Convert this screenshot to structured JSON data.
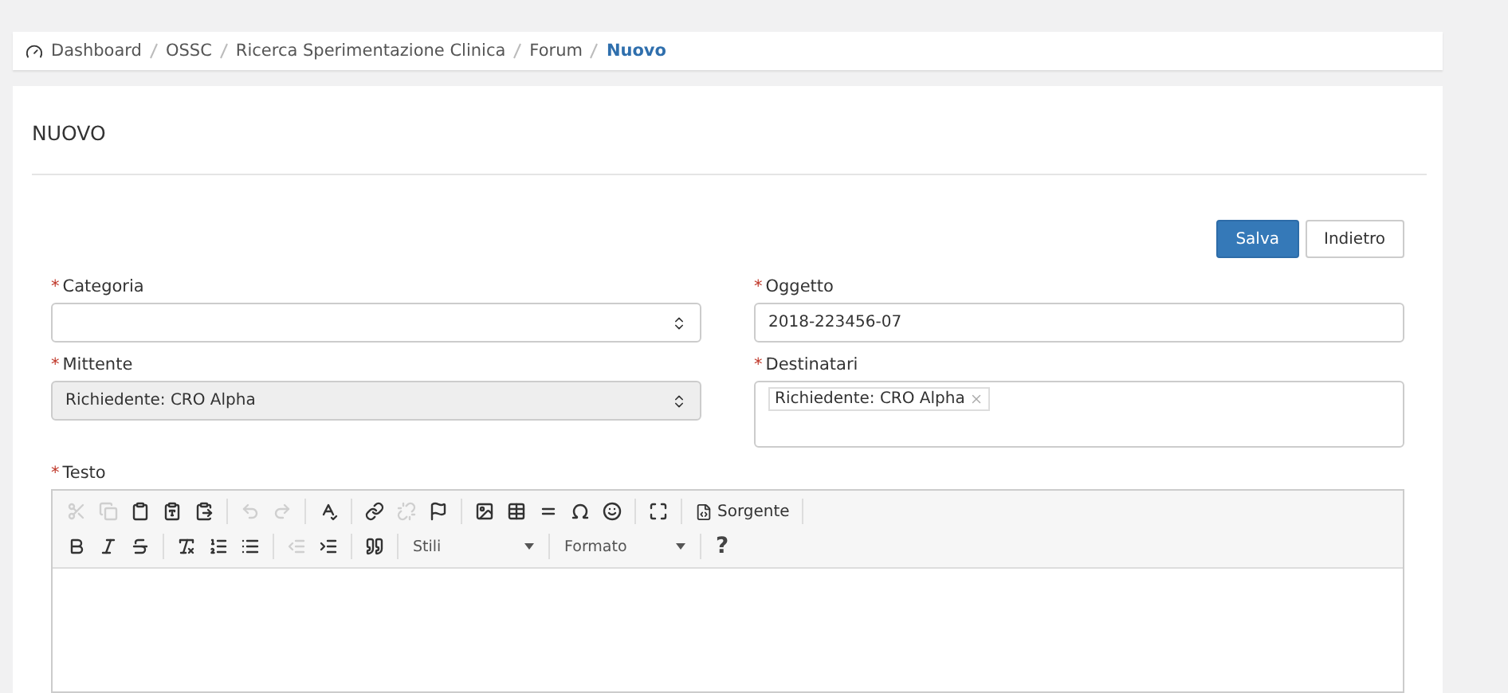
{
  "breadcrumb": [
    {
      "label": "Dashboard",
      "current": false
    },
    {
      "label": "OSSC",
      "current": false
    },
    {
      "label": "Ricerca Sperimentazione Clinica",
      "current": false
    },
    {
      "label": "Forum",
      "current": false
    },
    {
      "label": "Nuovo",
      "current": true
    }
  ],
  "page_title": "NUOVO",
  "buttons": [
    {
      "label": "Salva",
      "kind": "primary"
    },
    {
      "label": "Indietro",
      "kind": "default"
    }
  ],
  "fields": [
    {
      "label": "Categoria",
      "required_mark": "*",
      "kind": "select",
      "disabled": false
    },
    {
      "label": "Oggetto",
      "required_mark": "*",
      "kind": "text",
      "value": "2018-223456-07",
      "disabled": false
    },
    {
      "label": "Mittente",
      "required_mark": "*",
      "kind": "select",
      "value": "Richiedente: CRO Alpha",
      "disabled": true
    },
    {
      "label": "Destinatari",
      "required_mark": "*",
      "kind": "tags",
      "tags": [
        "Richiedente: CRO Alpha"
      ],
      "disabled": false
    }
  ],
  "editor": {
    "label": "Testo",
    "required_mark": "*",
    "toolbar": [
      [
        {
          "kind": "cut",
          "disabled": true
        },
        {
          "kind": "copy",
          "disabled": true
        },
        {
          "kind": "paste",
          "disabled": false
        },
        {
          "kind": "paste-text",
          "disabled": false
        },
        {
          "kind": "paste-word",
          "disabled": false
        },
        {
          "kind": "sep"
        },
        {
          "kind": "undo",
          "disabled": true
        },
        {
          "kind": "redo",
          "disabled": true
        },
        {
          "kind": "sep"
        },
        {
          "kind": "spellcheck",
          "disabled": false
        },
        {
          "kind": "sep"
        },
        {
          "kind": "link",
          "disabled": false
        },
        {
          "kind": "unlink",
          "disabled": true
        },
        {
          "kind": "anchor",
          "disabled": false
        },
        {
          "kind": "sep"
        },
        {
          "kind": "image",
          "disabled": false
        },
        {
          "kind": "table",
          "disabled": false
        },
        {
          "kind": "hr",
          "disabled": false
        },
        {
          "kind": "omega",
          "disabled": false
        },
        {
          "kind": "smiley",
          "disabled": false
        },
        {
          "kind": "sep"
        },
        {
          "kind": "maximize",
          "disabled": false
        },
        {
          "kind": "sep"
        },
        {
          "kind": "source",
          "label": "Sorgente",
          "disabled": false
        },
        {
          "kind": "sep"
        }
      ],
      [
        {
          "kind": "bold",
          "disabled": false
        },
        {
          "kind": "italic",
          "disabled": false
        },
        {
          "kind": "strike",
          "disabled": false
        },
        {
          "kind": "sep"
        },
        {
          "kind": "clear",
          "disabled": false
        },
        {
          "kind": "ol",
          "disabled": false
        },
        {
          "kind": "ul",
          "disabled": false
        },
        {
          "kind": "sep"
        },
        {
          "kind": "outdent",
          "disabled": true
        },
        {
          "kind": "indent",
          "disabled": false
        },
        {
          "kind": "sep"
        },
        {
          "kind": "quote",
          "disabled": false
        },
        {
          "kind": "sep"
        },
        {
          "kind": "combo",
          "label": "Stili"
        },
        {
          "kind": "sep"
        },
        {
          "kind": "combo",
          "label": "Formato"
        },
        {
          "kind": "sep"
        },
        {
          "kind": "help",
          "label": "?"
        }
      ]
    ]
  }
}
